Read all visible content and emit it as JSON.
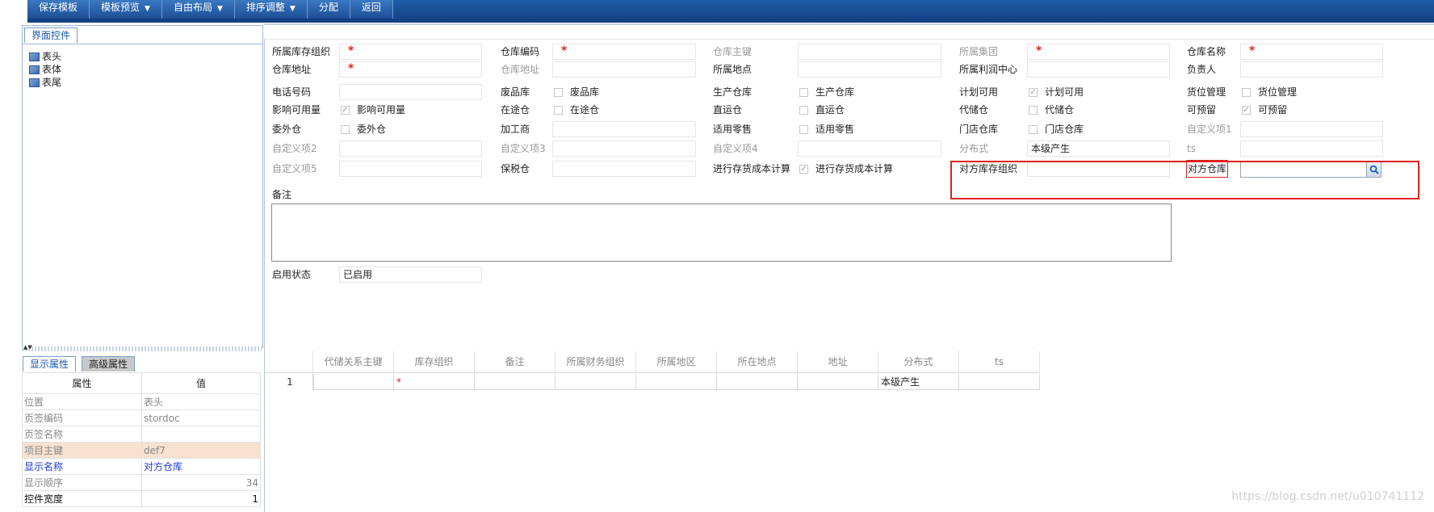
{
  "toolbar": {
    "buttons": [
      {
        "label": "保存模板",
        "has_caret": false
      },
      {
        "label": "模板预览",
        "has_caret": true
      },
      {
        "label": "自由布局",
        "has_caret": true
      },
      {
        "label": "排序调整",
        "has_caret": true
      },
      {
        "label": "分配",
        "has_caret": false
      },
      {
        "label": "返回",
        "has_caret": false
      }
    ]
  },
  "left_panel": {
    "tab_label": "界面控件",
    "tree_items": [
      "表头",
      "表体",
      "表尾"
    ]
  },
  "props_panel": {
    "tabs": [
      "显示属性",
      "高级属性"
    ],
    "headers": {
      "key": "属性",
      "value": "值"
    },
    "rows": [
      {
        "key": "位置",
        "value": "表头"
      },
      {
        "key": "页签编码",
        "value": "stordoc"
      },
      {
        "key": "页签名称",
        "value": ""
      },
      {
        "key": "项目主键",
        "value": "def7"
      },
      {
        "key": "显示名称",
        "value": "对方仓库"
      },
      {
        "key": "显示顺序",
        "value": "34"
      },
      {
        "key": "控件宽度",
        "value": "1"
      }
    ]
  },
  "form": {
    "labels": {
      "r1c1": "所属库存组织",
      "r1c2": "仓库编码",
      "r1c3": "仓库主键",
      "r1c4": "所属集团",
      "r1c5": "仓库名称",
      "r2c1": "仓库地址",
      "r2c2": "仓库地址",
      "r2c3": "所属地点",
      "r2c4": "所属利润中心",
      "r2c5": "负责人",
      "r3c1": "电话号码",
      "r3c2": "废品库",
      "r3c3": "生产仓库",
      "r3c4": "计划可用",
      "r3c5": "货位管理",
      "r4c1": "影响可用量",
      "r4c2": "在途仓",
      "r4c3": "直运仓",
      "r4c4": "代储仓",
      "r4c5": "可预留",
      "r5c1": "委外仓",
      "r5c2": "加工商",
      "r5c3": "适用零售",
      "r5c4": "门店仓库",
      "r5c5": "自定义项1",
      "r6c1": "自定义项2",
      "r6c2": "自定义项3",
      "r6c3": "自定义项4",
      "r6c4": "分布式",
      "r6c5": "ts",
      "r7c1": "自定义项5",
      "r7c2": "保税仓",
      "r7c3": "进行存货成本计算",
      "r7c4": "对方库存组织",
      "r7c5": "对方仓库",
      "remark": "备注",
      "status": "启用状态"
    },
    "checks": {
      "r3c2": "废品库",
      "r3c3": "生产仓库",
      "r3c4": "计划可用",
      "r3c5": "货位管理",
      "r4c1": "影响可用量",
      "r4c2": "在途仓",
      "r4c3": "直运仓",
      "r4c4": "代储仓",
      "r4c5": "可预留",
      "r5c1": "委外仓",
      "r5c3": "适用零售",
      "r5c4": "门店仓库",
      "r7c3": "进行存货成本计算"
    },
    "values": {
      "r6c4": "本级产生",
      "status": "已启用"
    }
  },
  "grid": {
    "columns": [
      "代储关系主键",
      "库存组织",
      "备注",
      "所属财务组织",
      "所属地区",
      "所在地点",
      "地址",
      "分布式",
      "ts"
    ],
    "rows": [
      {
        "num": "1",
        "cells": [
          "",
          "*",
          "",
          "",
          "",
          "",
          "",
          "本级产生",
          ""
        ]
      }
    ]
  },
  "watermark": "https://blog.csdn.net/u010741112"
}
